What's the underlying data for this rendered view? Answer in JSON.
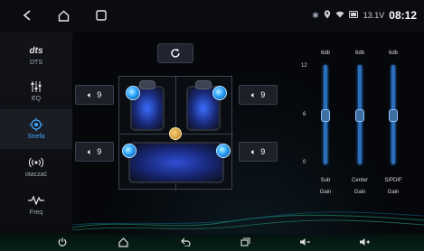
{
  "status": {
    "battery_voltage": "13.1V",
    "time": "08:12"
  },
  "sidebar": {
    "items": [
      {
        "logo": "dts",
        "label": "DTS"
      },
      {
        "label": "EQ"
      },
      {
        "label": "Strefa"
      },
      {
        "label": "otaczać"
      },
      {
        "label": "Freq"
      }
    ]
  },
  "speakers": {
    "front_left": "9",
    "front_right": "9",
    "rear_left": "9",
    "rear_right": "9"
  },
  "eq": {
    "scale_top": "12",
    "scale_mid": "6",
    "scale_bottom": "0",
    "channels": [
      {
        "top": "6db",
        "label_line1": "Sub",
        "label_line2": "Gain",
        "level_fraction": 0.5
      },
      {
        "top": "6db",
        "label_line1": "Center",
        "label_line2": "Gain",
        "level_fraction": 0.5
      },
      {
        "top": "6db",
        "label_line1": "S/PDIF",
        "label_line2": "Gain",
        "level_fraction": 0.5
      }
    ]
  },
  "icons": {
    "back": "back-icon",
    "home": "home-icon",
    "recents": "square-icon",
    "bluetooth": "bluetooth-icon",
    "location": "location-icon",
    "wifi": "wifi-icon",
    "battery": "battery-icon",
    "reset": "reset-icon",
    "speaker": "speaker-icon",
    "power": "power-icon",
    "volume_down": "volume-down-icon",
    "volume_up": "volume-up-icon"
  },
  "colors": {
    "accent": "#3fa9ff",
    "seat_glow": "#3a6cff",
    "eq_track": "#2b6fb8"
  }
}
